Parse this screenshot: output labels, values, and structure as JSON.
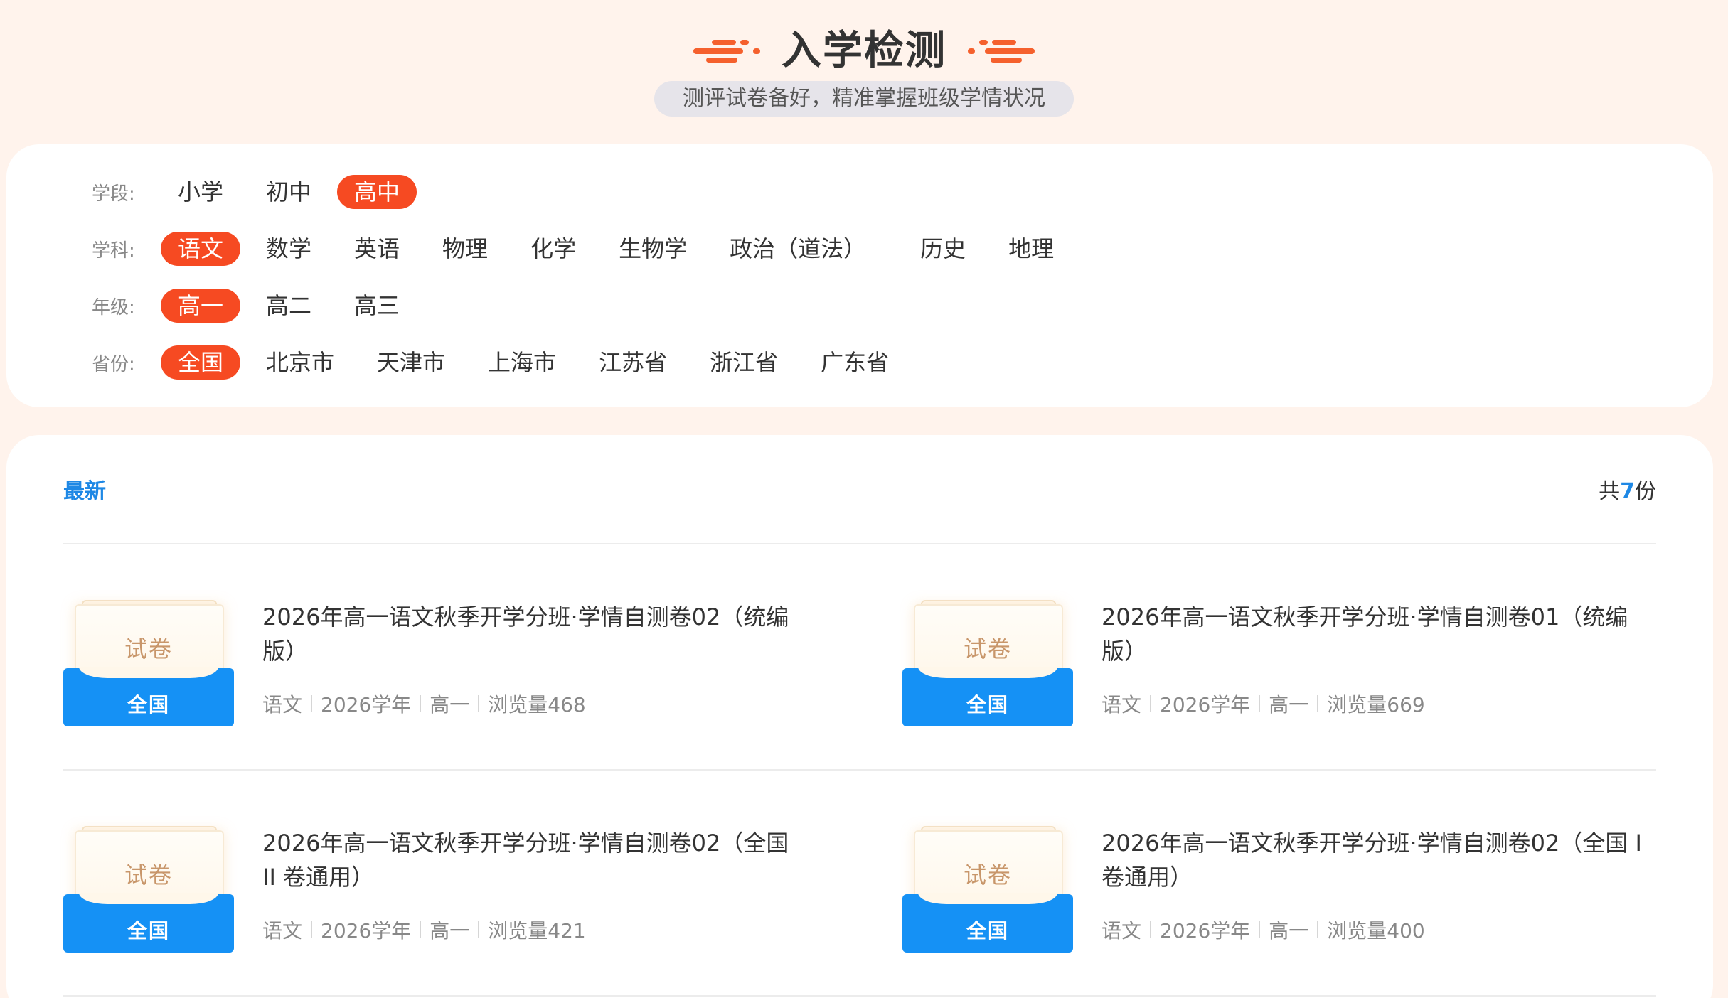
{
  "header": {
    "title": "入学检测",
    "subtitle": "测评试卷备好，精准掌握班级学情状况"
  },
  "colors": {
    "accent": "#f64a22",
    "link": "#1e88e5",
    "envelope": "#1591f5",
    "background": "#fff3ec"
  },
  "filters": {
    "stage": {
      "label": "学段:",
      "options": [
        "小学",
        "初中",
        "高中"
      ],
      "active": "高中"
    },
    "subject": {
      "label": "学科:",
      "options": [
        "语文",
        "数学",
        "英语",
        "物理",
        "化学",
        "生物学",
        "政治（道法）",
        "历史",
        "地理"
      ],
      "active": "语文"
    },
    "grade": {
      "label": "年级:",
      "options": [
        "高一",
        "高二",
        "高三"
      ],
      "active": "高一"
    },
    "province": {
      "label": "省份:",
      "options": [
        "全国",
        "北京市",
        "天津市",
        "上海市",
        "江苏省",
        "浙江省",
        "广东省"
      ],
      "active": "全国"
    }
  },
  "list": {
    "tab_latest": "最新",
    "total_prefix": "共",
    "total_count": "7",
    "total_suffix": "份",
    "thumb_paper_label": "试卷",
    "items": [
      {
        "title": "2026年高一语文秋季开学分班·学情自测卷02（统编版）",
        "region": "全国",
        "subject": "语文",
        "year": "2026学年",
        "grade": "高一",
        "views": "浏览量468"
      },
      {
        "title": "2026年高一语文秋季开学分班·学情自测卷01（统编版）",
        "region": "全国",
        "subject": "语文",
        "year": "2026学年",
        "grade": "高一",
        "views": "浏览量669"
      },
      {
        "title": "2026年高一语文秋季开学分班·学情自测卷02（全国 II 卷通用）",
        "region": "全国",
        "subject": "语文",
        "year": "2026学年",
        "grade": "高一",
        "views": "浏览量421"
      },
      {
        "title": "2026年高一语文秋季开学分班·学情自测卷02（全国 I 卷通用）",
        "region": "全国",
        "subject": "语文",
        "year": "2026学年",
        "grade": "高一",
        "views": "浏览量400"
      }
    ]
  }
}
